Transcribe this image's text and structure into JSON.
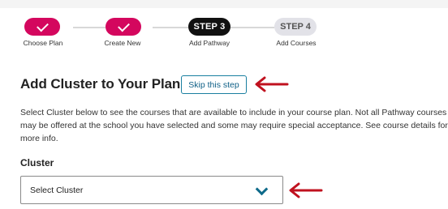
{
  "stepper": {
    "steps": [
      {
        "badge": "",
        "label": "Choose Plan",
        "state": "done",
        "icon": "check-icon"
      },
      {
        "badge": "",
        "label": "Create New",
        "state": "done",
        "icon": "check-icon"
      },
      {
        "badge": "STEP 3",
        "label": "Add Pathway",
        "state": "active"
      },
      {
        "badge": "STEP 4",
        "label": "Add Courses",
        "state": "todo"
      }
    ]
  },
  "main": {
    "title": "Add Cluster to Your Plan",
    "skip_label": "Skip this step",
    "description": "Select Cluster below to see the courses that are available to include in your course plan. Not all Pathway courses may be offered at the school you have selected and some may require special acceptance. See course details for more info.",
    "cluster_label": "Cluster",
    "cluster_select_value": "Select Cluster"
  },
  "colors": {
    "done": "#d4075e",
    "active": "#111111",
    "todo": "#e2e2e8",
    "link": "#0e5f86",
    "annotation_arrow": "#c0111f"
  },
  "icons": [
    "check-icon",
    "chevron-down-icon",
    "left-arrow-icon"
  ]
}
